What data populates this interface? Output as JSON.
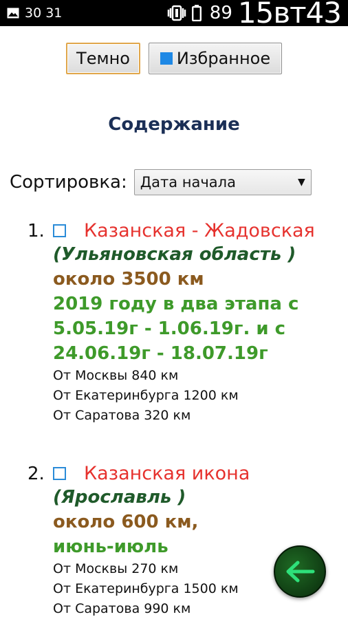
{
  "status_bar": {
    "left_icon": "image-icon",
    "left_numbers": "30  31",
    "vibrate_icon": "vibrate-icon",
    "battery_icon": "battery-icon",
    "battery_level": "89",
    "clock": "15вт43"
  },
  "buttons": {
    "dark_label": "Темно",
    "favorites_label": "Избранное",
    "favorites_marker_color": "#1e88e5"
  },
  "heading": "Содержание",
  "sort": {
    "label": "Сортировка:",
    "selected": "Дата начала"
  },
  "entries": [
    {
      "number": "1.",
      "title": "Казанская - Жадовская",
      "region": "(Ульяновская область )",
      "distance": "около 3500 км",
      "dates": [
        "2019 году в два этапа с",
        "5.05.19г - 1.06.19г. и с",
        "24.06.19г - 18.07.19г"
      ],
      "from": [
        "От Москвы 840 км",
        "От Екатеринбурга 1200 км",
        "От Саратова 320 км"
      ]
    },
    {
      "number": "2.",
      "title": "Казанская икона",
      "region": "(Ярославль )",
      "distance": "около 600 км,",
      "dates": [
        "июнь-июль"
      ],
      "from": [
        "От Москвы 270 км",
        "От Екатеринбурга 1500 км",
        "От Саратова 990 км"
      ]
    }
  ],
  "fab": {
    "icon": "arrow-left-icon",
    "arrow_color": "#2ee07a"
  },
  "colors": {
    "title_red": "#e6322e",
    "region_green": "#1f5a2a",
    "distance_brown": "#8b5a1f",
    "dates_green": "#3e9a2a",
    "heading_navy": "#1b2f56",
    "checkbox_blue": "#2a8bd8"
  }
}
